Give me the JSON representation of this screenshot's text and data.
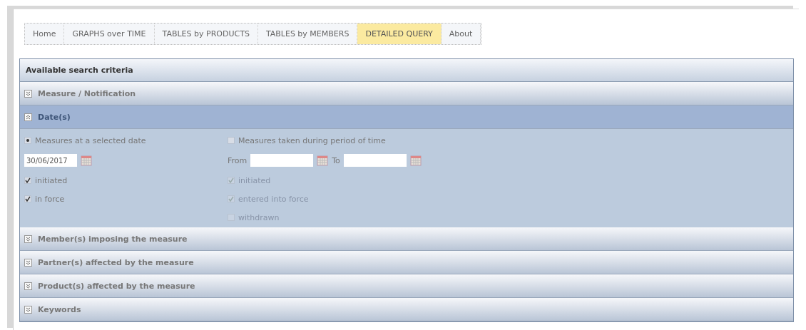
{
  "tabs": [
    {
      "label": "Home",
      "selected": false
    },
    {
      "label": "GRAPHS over TIME",
      "selected": false
    },
    {
      "label": "TABLES by PRODUCTS",
      "selected": false
    },
    {
      "label": "TABLES by MEMBERS",
      "selected": false
    },
    {
      "label": "DETAILED QUERY",
      "selected": true
    },
    {
      "label": "About",
      "selected": false
    }
  ],
  "panel": {
    "title": "Available search criteria",
    "sections": [
      {
        "title": "Measure / Notification",
        "expanded": false
      },
      {
        "title": "Date(s)",
        "expanded": true,
        "kind": "dates"
      },
      {
        "title": "Member(s) imposing the measure",
        "expanded": false
      },
      {
        "title": "Partner(s) affected by the measure",
        "expanded": false
      },
      {
        "title": "Product(s) affected by the measure",
        "expanded": false
      },
      {
        "title": "Keywords",
        "expanded": false
      }
    ]
  },
  "dates": {
    "left": {
      "option": {
        "label": "Measures at a selected date",
        "selected": true
      },
      "date": "30/06/2017",
      "checks": [
        {
          "label": "initiated",
          "checked": true
        },
        {
          "label": "in force",
          "checked": true
        }
      ]
    },
    "right": {
      "option": {
        "label": "Measures taken during period of time",
        "selected": false
      },
      "from_label": "From",
      "to_label": "To",
      "checks": [
        {
          "label": "initiated",
          "checked": true,
          "disabled": true
        },
        {
          "label": "entered into force",
          "checked": true,
          "disabled": true
        },
        {
          "label": "withdrawn",
          "checked": false,
          "disabled": true
        }
      ]
    }
  }
}
